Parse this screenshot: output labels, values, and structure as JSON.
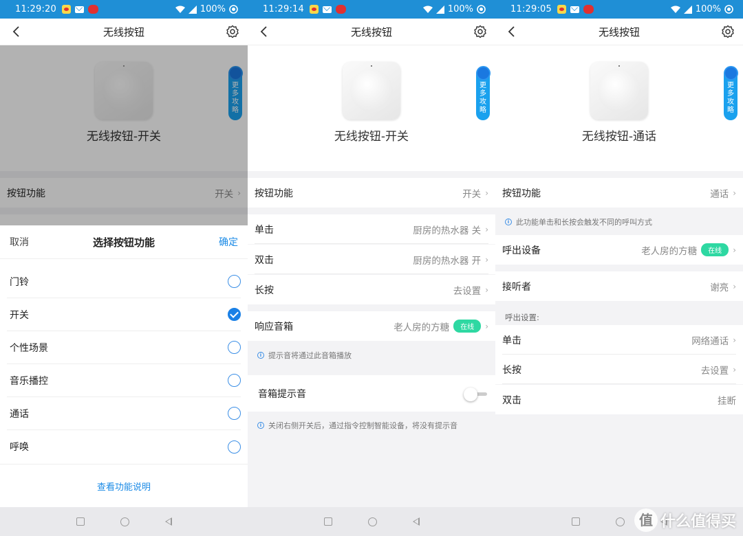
{
  "status": [
    {
      "time": "11:29:20",
      "battery": "100%"
    },
    {
      "time": "11:29:14",
      "battery": "100%"
    },
    {
      "time": "11:29:05",
      "battery": "100%"
    }
  ],
  "nav_title": "无线按钮",
  "more_guide": [
    "更",
    "多",
    "攻",
    "略"
  ],
  "panel1": {
    "device_name": "无线按钮-开关",
    "row_function": {
      "label": "按钮功能",
      "value": "开关"
    },
    "sheet": {
      "cancel": "取消",
      "title": "选择按钮功能",
      "confirm": "确定",
      "options": [
        {
          "label": "门铃",
          "selected": false
        },
        {
          "label": "开关",
          "selected": true
        },
        {
          "label": "个性场景",
          "selected": false
        },
        {
          "label": "音乐播控",
          "selected": false
        },
        {
          "label": "通话",
          "selected": false
        },
        {
          "label": "呼唤",
          "selected": false
        }
      ],
      "link": "查看功能说明"
    }
  },
  "panel2": {
    "device_name": "无线按钮-开关",
    "row_function": {
      "label": "按钮功能",
      "value": "开关"
    },
    "row_single": {
      "label": "单击",
      "value": "厨房的热水器 关"
    },
    "row_double": {
      "label": "双击",
      "value": "厨房的热水器 开"
    },
    "row_long": {
      "label": "长按",
      "value": "去设置"
    },
    "row_speaker": {
      "label": "响应音箱",
      "value": "老人房的方糖",
      "badge": "在线"
    },
    "note1": "提示音将通过此音箱播放",
    "row_tone": {
      "label": "音箱提示音",
      "enabled": false
    },
    "note2": "关闭右侧开关后，通过指令控制智能设备，将没有提示音"
  },
  "panel3": {
    "device_name": "无线按钮-通话",
    "row_function": {
      "label": "按钮功能",
      "value": "通话"
    },
    "note1": "此功能单击和长按会触发不同的呼叫方式",
    "row_caller": {
      "label": "呼出设备",
      "value": "老人房的方糖",
      "badge": "在线"
    },
    "row_receiver": {
      "label": "接听者",
      "value": "谢亮"
    },
    "section": "呼出设置:",
    "row_single": {
      "label": "单击",
      "value": "网络通话"
    },
    "row_long": {
      "label": "长按",
      "value": "去设置"
    },
    "row_double": {
      "label": "双击",
      "value": "挂断"
    }
  },
  "watermark": {
    "icon": "值",
    "text": "什么值得买"
  },
  "colors": {
    "statusbar": "#1f8fd6",
    "accent": "#1a8ae6",
    "badge": "#2ed8a2"
  }
}
